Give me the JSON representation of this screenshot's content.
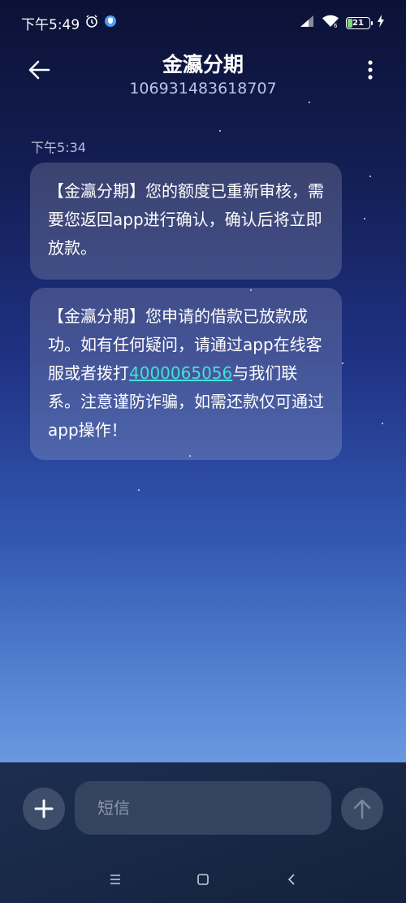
{
  "status_bar": {
    "time": "下午5:49",
    "battery": "21"
  },
  "header": {
    "title": "金瀛分期",
    "sender_number": "106931483618707"
  },
  "conversation": {
    "timestamp": "下午5:34",
    "messages": [
      {
        "text": "【金瀛分期】您的额度已重新审核，需要您返回app进行确认，确认后将立即放款。"
      },
      {
        "text_before": "【金瀛分期】您申请的借款已放款成功。如有任何疑问，请通过app在线客服或者拨打",
        "phone": "4000065056",
        "text_after": "与我们联系。注意谨防诈骗，如需还款仅可通过app操作！"
      }
    ]
  },
  "composer": {
    "placeholder": "短信"
  },
  "colors": {
    "link": "#3fe3d9",
    "bubble": "rgba(255,255,255,0.17)"
  },
  "icons": [
    "alarm-icon",
    "shield-icon",
    "signal-icon",
    "wifi-icon",
    "battery-icon",
    "charging-icon",
    "back-arrow-icon",
    "more-vertical-icon",
    "plus-icon",
    "send-arrow-icon",
    "menu-icon",
    "home-icon",
    "back-triangle-icon"
  ]
}
